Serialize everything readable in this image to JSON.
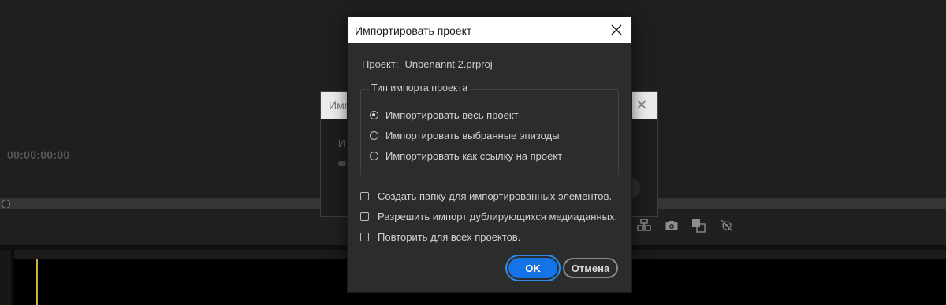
{
  "background": {
    "timecode": "00:00:00:00",
    "underlying_dialog": {
      "title": "Имп",
      "label": "И"
    },
    "tool_icons": [
      "insert-icon",
      "camera-icon",
      "compare-icon",
      "settings-icon"
    ]
  },
  "dialog": {
    "title": "Импортировать проект",
    "close_icon": "close-icon",
    "project_label": "Проект:",
    "project_name": "Unbenannt 2.prproj",
    "import_type": {
      "legend": "Тип импорта проекта",
      "options": [
        {
          "label": "Импортировать весь проект",
          "selected": true
        },
        {
          "label": "Импортировать выбранные эпизоды",
          "selected": false
        },
        {
          "label": "Импортировать как ссылку на проект",
          "selected": false
        }
      ]
    },
    "checkboxes": [
      {
        "label": "Создать папку для импортированных элементов.",
        "checked": false
      },
      {
        "label": "Разрешить импорт дублирующихся медиаданных.",
        "checked": false
      },
      {
        "label": "Повторить для всех проектов.",
        "checked": false
      }
    ],
    "ok_label": "OK",
    "cancel_label": "Отмена"
  },
  "colors": {
    "accent": "#1473e6",
    "dialog_bg": "#2c2c2c",
    "titlebar_bg": "#ffffff",
    "playhead": "#d9c23a"
  }
}
